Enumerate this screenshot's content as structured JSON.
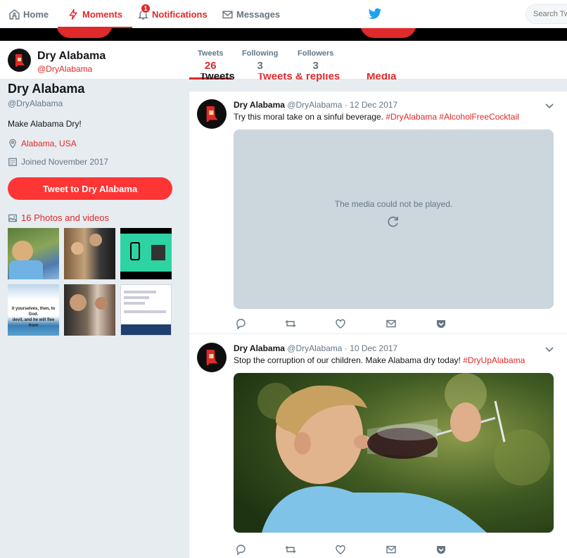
{
  "nav": {
    "home": "Home",
    "moments": "Moments",
    "notifications": "Notifications",
    "notifications_badge": "1",
    "messages": "Messages",
    "search_placeholder": "Search Tw"
  },
  "profile_bar": {
    "name": "Dry Alabama",
    "handle": "@DryAlabama",
    "stats": [
      {
        "label": "Tweets",
        "value": "26"
      },
      {
        "label": "Following",
        "value": "3"
      },
      {
        "label": "Followers",
        "value": "3"
      }
    ]
  },
  "tabs": [
    "Tweets",
    "Tweets & replies",
    "Media"
  ],
  "sidebar": {
    "name": "Dry Alabama",
    "handle": "@DryAlabama",
    "bio": "Make Alabama Dry!",
    "location": "Alabama, USA",
    "joined": "Joined November 2017",
    "tweet_to_button": "Tweet to Dry Alabama",
    "photos_link": "16 Photos and videos",
    "thumb_texts": {
      "t6_line1": "it yourselves, then, to God.",
      "t6_line2": "devil, and he will flee from"
    }
  },
  "tweets": [
    {
      "name": "Dry Alabama",
      "handle": "@DryAlabama",
      "dot": "·",
      "date": "12 Dec 2017",
      "text": "Try this moral take on a sinful beverage.",
      "hashtag1": "#DryAlabama",
      "hashtag2": "#AlcoholFreeCocktail",
      "media_message": "The media could not be played."
    },
    {
      "name": "Dry Alabama",
      "handle": "@DryAlabama",
      "dot": "·",
      "date": "10 Dec 2017",
      "text": "Stop the corruption of our children. Make Alabama dry today!",
      "hashtag1": "#DryUpAlabama"
    }
  ],
  "colors": {
    "accent": "#e0292a",
    "button": "#fe3535",
    "twitter_blue": "#1da1f2",
    "page_bg": "#e6ecf0"
  }
}
